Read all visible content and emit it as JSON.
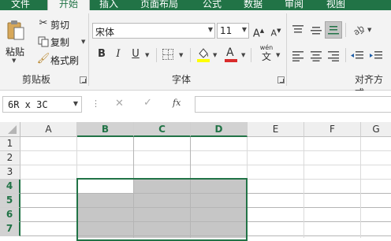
{
  "tabs": [
    {
      "label": "文件"
    },
    {
      "label": "开始"
    },
    {
      "label": "插入"
    },
    {
      "label": "页面布局"
    },
    {
      "label": "公式"
    },
    {
      "label": "数据"
    },
    {
      "label": "审阅"
    },
    {
      "label": "视图"
    }
  ],
  "clipboard": {
    "paste_label": "粘贴",
    "cut_label": "剪切",
    "copy_label": "复制",
    "format_painter_label": "格式刷",
    "group_label": "剪贴板"
  },
  "font": {
    "font_name": "宋体",
    "font_size": "11",
    "bold": "B",
    "italic": "I",
    "underline": "U",
    "phonetic_label": "wén",
    "phonetic_char": "文",
    "group_label": "字体"
  },
  "alignment": {
    "group_label": "对齐方式"
  },
  "formula_bar": {
    "name_box_value": "6R x 3C",
    "fx_label": "fx",
    "formula_value": ""
  },
  "sheet": {
    "columns": [
      "A",
      "B",
      "C",
      "D",
      "E",
      "F",
      "G"
    ],
    "rows": [
      "1",
      "2",
      "3",
      "4",
      "5",
      "6",
      "7"
    ],
    "selected_columns": [
      "B",
      "C",
      "D"
    ],
    "selected_rows": [
      "4",
      "5",
      "6",
      "7"
    ]
  },
  "colors": {
    "accent": "#217346",
    "selection_fill": "#c6c6c6"
  }
}
